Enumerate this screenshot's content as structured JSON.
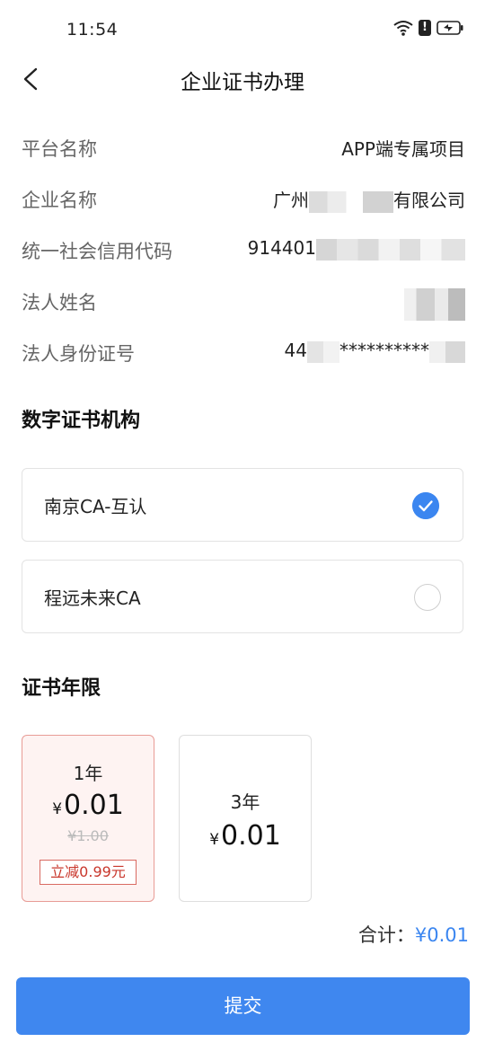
{
  "status_bar": {
    "time": "11:54"
  },
  "nav": {
    "title": "企业证书办理"
  },
  "info": [
    {
      "label": "平台名称",
      "value": "APP端专属项目"
    },
    {
      "label": "企业名称",
      "value_prefix": "广州",
      "value_suffix": "有限公司"
    },
    {
      "label": "统一社会信用代码",
      "value_prefix": "914401"
    },
    {
      "label": "法人姓名"
    },
    {
      "label": "法人身份证号",
      "value_prefix": "44",
      "value_middle": "**********"
    }
  ],
  "ca_section": {
    "title": "数字证书机构",
    "options": [
      {
        "name": "南京CA-互认",
        "selected": true
      },
      {
        "name": "程远未来CA",
        "selected": false
      }
    ]
  },
  "term_section": {
    "title": "证书年限",
    "cards": [
      {
        "years": "1年",
        "currency": "¥",
        "price": "0.01",
        "original": "¥1.00",
        "discount": "立减0.99元",
        "selected": true
      },
      {
        "years": "3年",
        "currency": "¥",
        "price": "0.01",
        "selected": false
      }
    ]
  },
  "total": {
    "label": "合计：",
    "amount": "¥0.01"
  },
  "submit_label": "提交",
  "colors": {
    "accent": "#3f87ef",
    "discount_red": "#c9372c"
  }
}
